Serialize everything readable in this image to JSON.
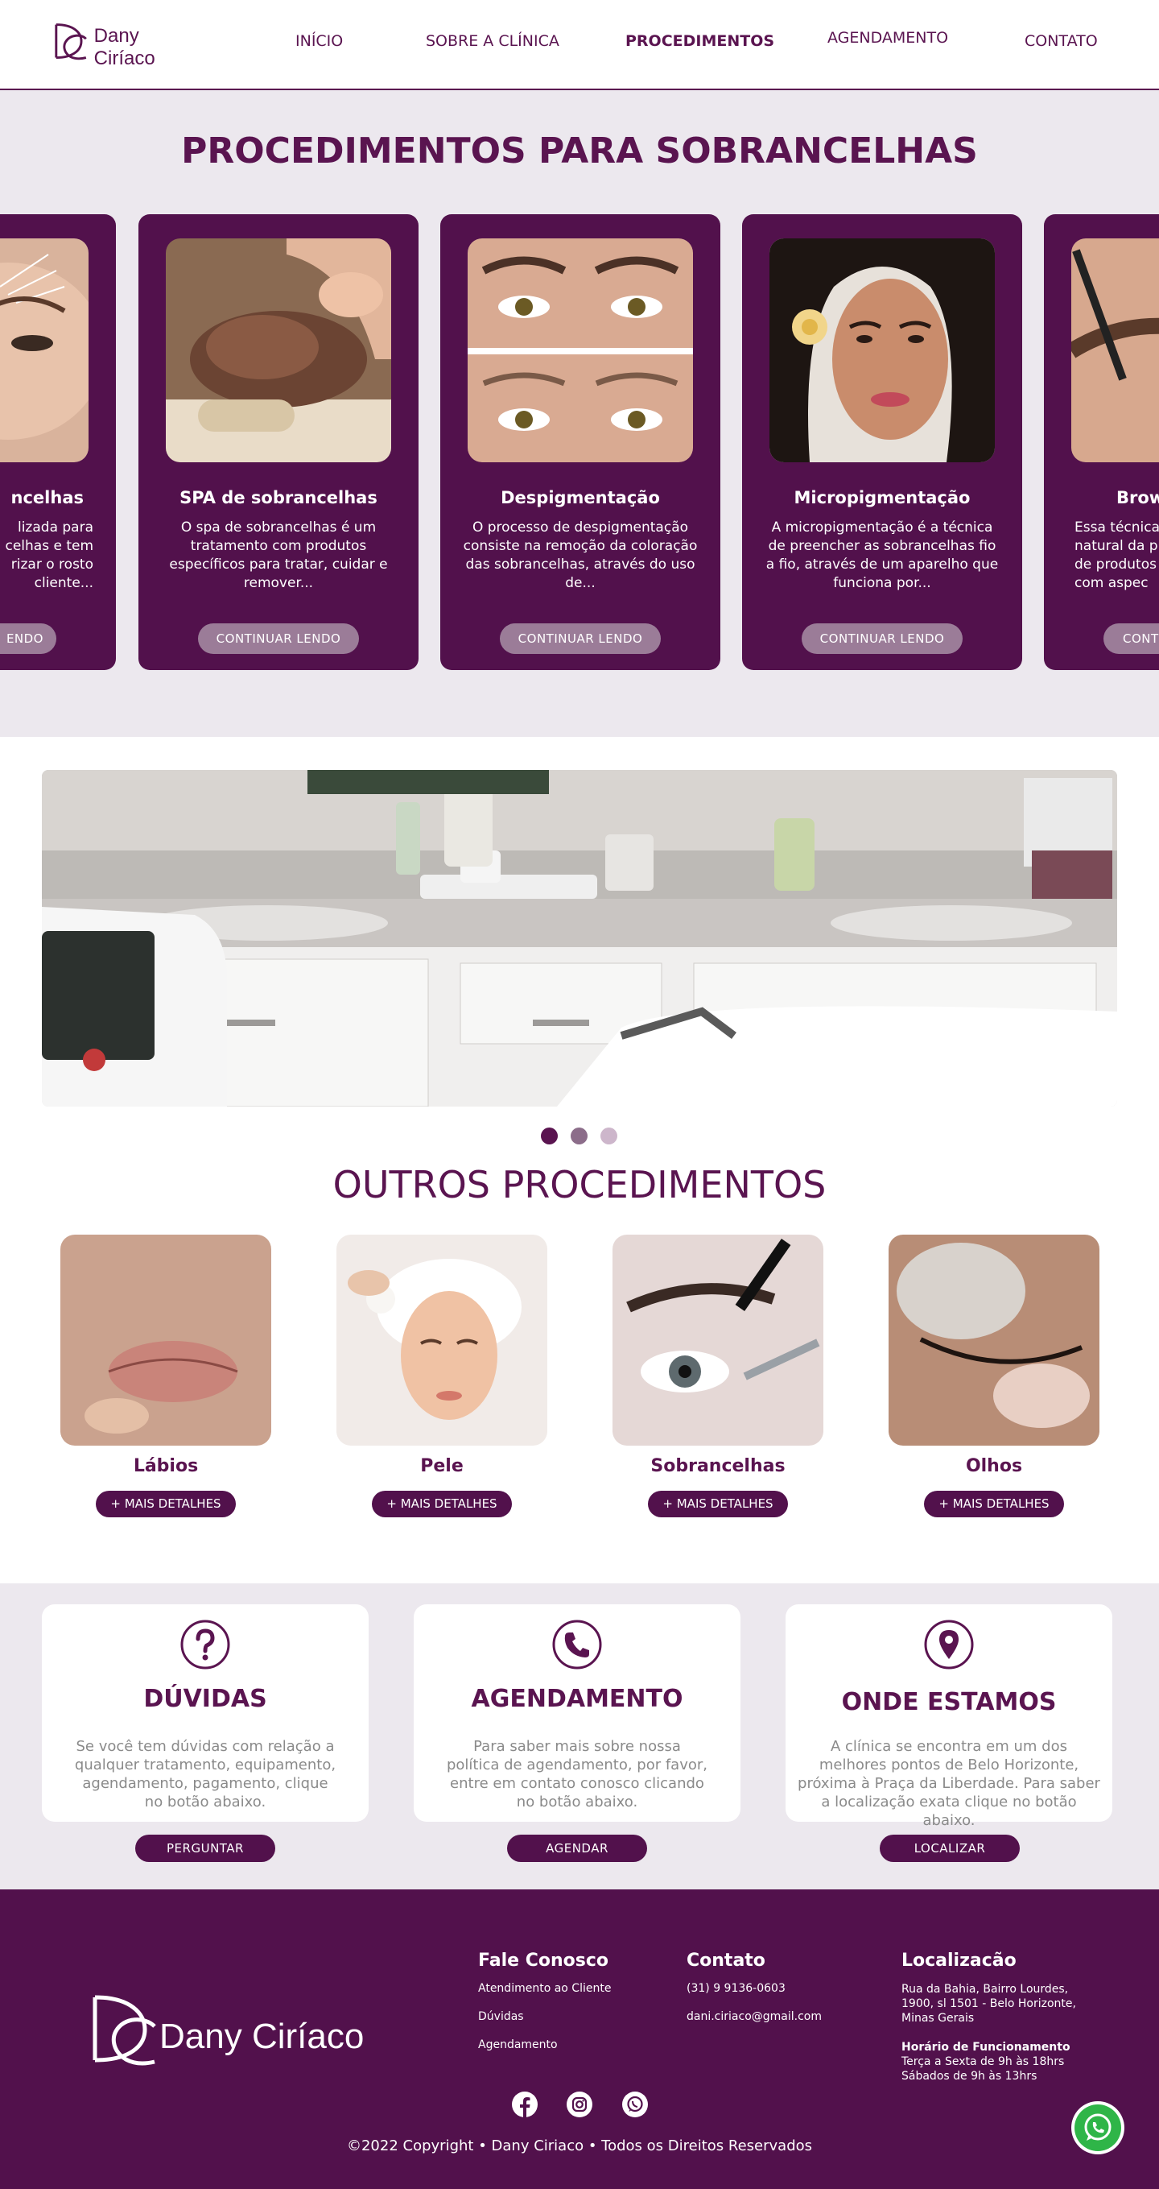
{
  "header": {
    "logo_text": "Dany Ciríaco",
    "nav": [
      {
        "label": "INÍCIO"
      },
      {
        "label": "SOBRE A CLÍNICA"
      },
      {
        "label": "PROCEDIMENTOS"
      },
      {
        "label": "AGENDAMENTO"
      },
      {
        "label": "CONTATO"
      }
    ]
  },
  "eyebrows": {
    "title": "PROCEDIMENTOS PARA SOBRANCELHAS",
    "cards": [
      {
        "title": "ncelhas",
        "desc": "lizada para\ncelhas e tem\nrizar o rosto\ncliente...",
        "button": "ENDO"
      },
      {
        "title": "SPA de sobrancelhas",
        "desc": "O spa de sobrancelhas é um tratamento com produtos específicos para tratar, cuidar e remover...",
        "button": "CONTINUAR LENDO"
      },
      {
        "title": "Despigmentação",
        "desc": "O processo de despigmentação consiste na remoção da coloração das sobrancelhas, através do uso de...",
        "button": "CONTINUAR LENDO"
      },
      {
        "title": "Micropigmentação",
        "desc": "A micropigmentação é a técnica de preencher as sobrancelhas fio a fio, através de um aparelho que funciona por...",
        "button": "CONTINUAR LENDO"
      },
      {
        "title": "Brow",
        "desc": "Essa técnica\nnatural da p\nde produtos\ncom aspec",
        "button": "CONT"
      }
    ]
  },
  "other": {
    "title": "OUTROS PROCEDIMENTOS",
    "items": [
      {
        "name": "Lábios",
        "button": "+ MAIS DETALHES"
      },
      {
        "name": "Pele",
        "button": "+ MAIS DETALHES"
      },
      {
        "name": "Sobrancelhas",
        "button": "+ MAIS DETALHES"
      },
      {
        "name": "Olhos",
        "button": "+ MAIS DETALHES"
      }
    ]
  },
  "info": [
    {
      "icon": "question-icon",
      "title": "DÚVIDAS",
      "text": "Se você tem dúvidas com relação a qualquer tratamento, equipamento, agendamento, pagamento, clique no botão abaixo.",
      "button": "PERGUNTAR"
    },
    {
      "icon": "phone-icon",
      "title": "AGENDAMENTO",
      "text": "Para saber mais sobre nossa política de agendamento, por favor, entre em contato conosco clicando no botão abaixo.",
      "button": "AGENDAR"
    },
    {
      "icon": "location-icon",
      "title": "ONDE ESTAMOS",
      "text": "A clínica se encontra em um dos melhores pontos de Belo Horizonte, próxima à Praça da Liberdade. Para saber a localização exata clique no botão abaixo.",
      "button": "LOCALIZAR"
    }
  ],
  "footer": {
    "logo_text": "Dany Ciríaco",
    "fale": {
      "heading": "Fale Conosco",
      "links": [
        "Atendimento ao Cliente",
        "Dúvidas",
        "Agendamento"
      ]
    },
    "contato": {
      "heading": "Contato",
      "phone": "(31) 9 9136-0603",
      "email": "dani.ciriaco@gmail.com"
    },
    "localizacao": {
      "heading": "Localizacão",
      "address": "Rua da Bahia, Bairro Lourdes, 1900, sl 1501 - Belo Horizonte, Minas Gerais",
      "hours_title": "Horário de Funcionamento",
      "hours_week": "Terça a Sexta de 9h às 18hrs",
      "hours_sat": "Sábados de 9h às 13hrs"
    },
    "social": [
      "facebook-icon",
      "instagram-icon",
      "whatsapp-icon"
    ],
    "copyright": "©2022 Copyright • Dany Ciriaco • Todos os Direitos Reservados"
  },
  "colors": {
    "brand": "#52114c",
    "title": "#5a1450",
    "bg_light": "#ece8ee",
    "button_muted": "#9b7c98"
  }
}
